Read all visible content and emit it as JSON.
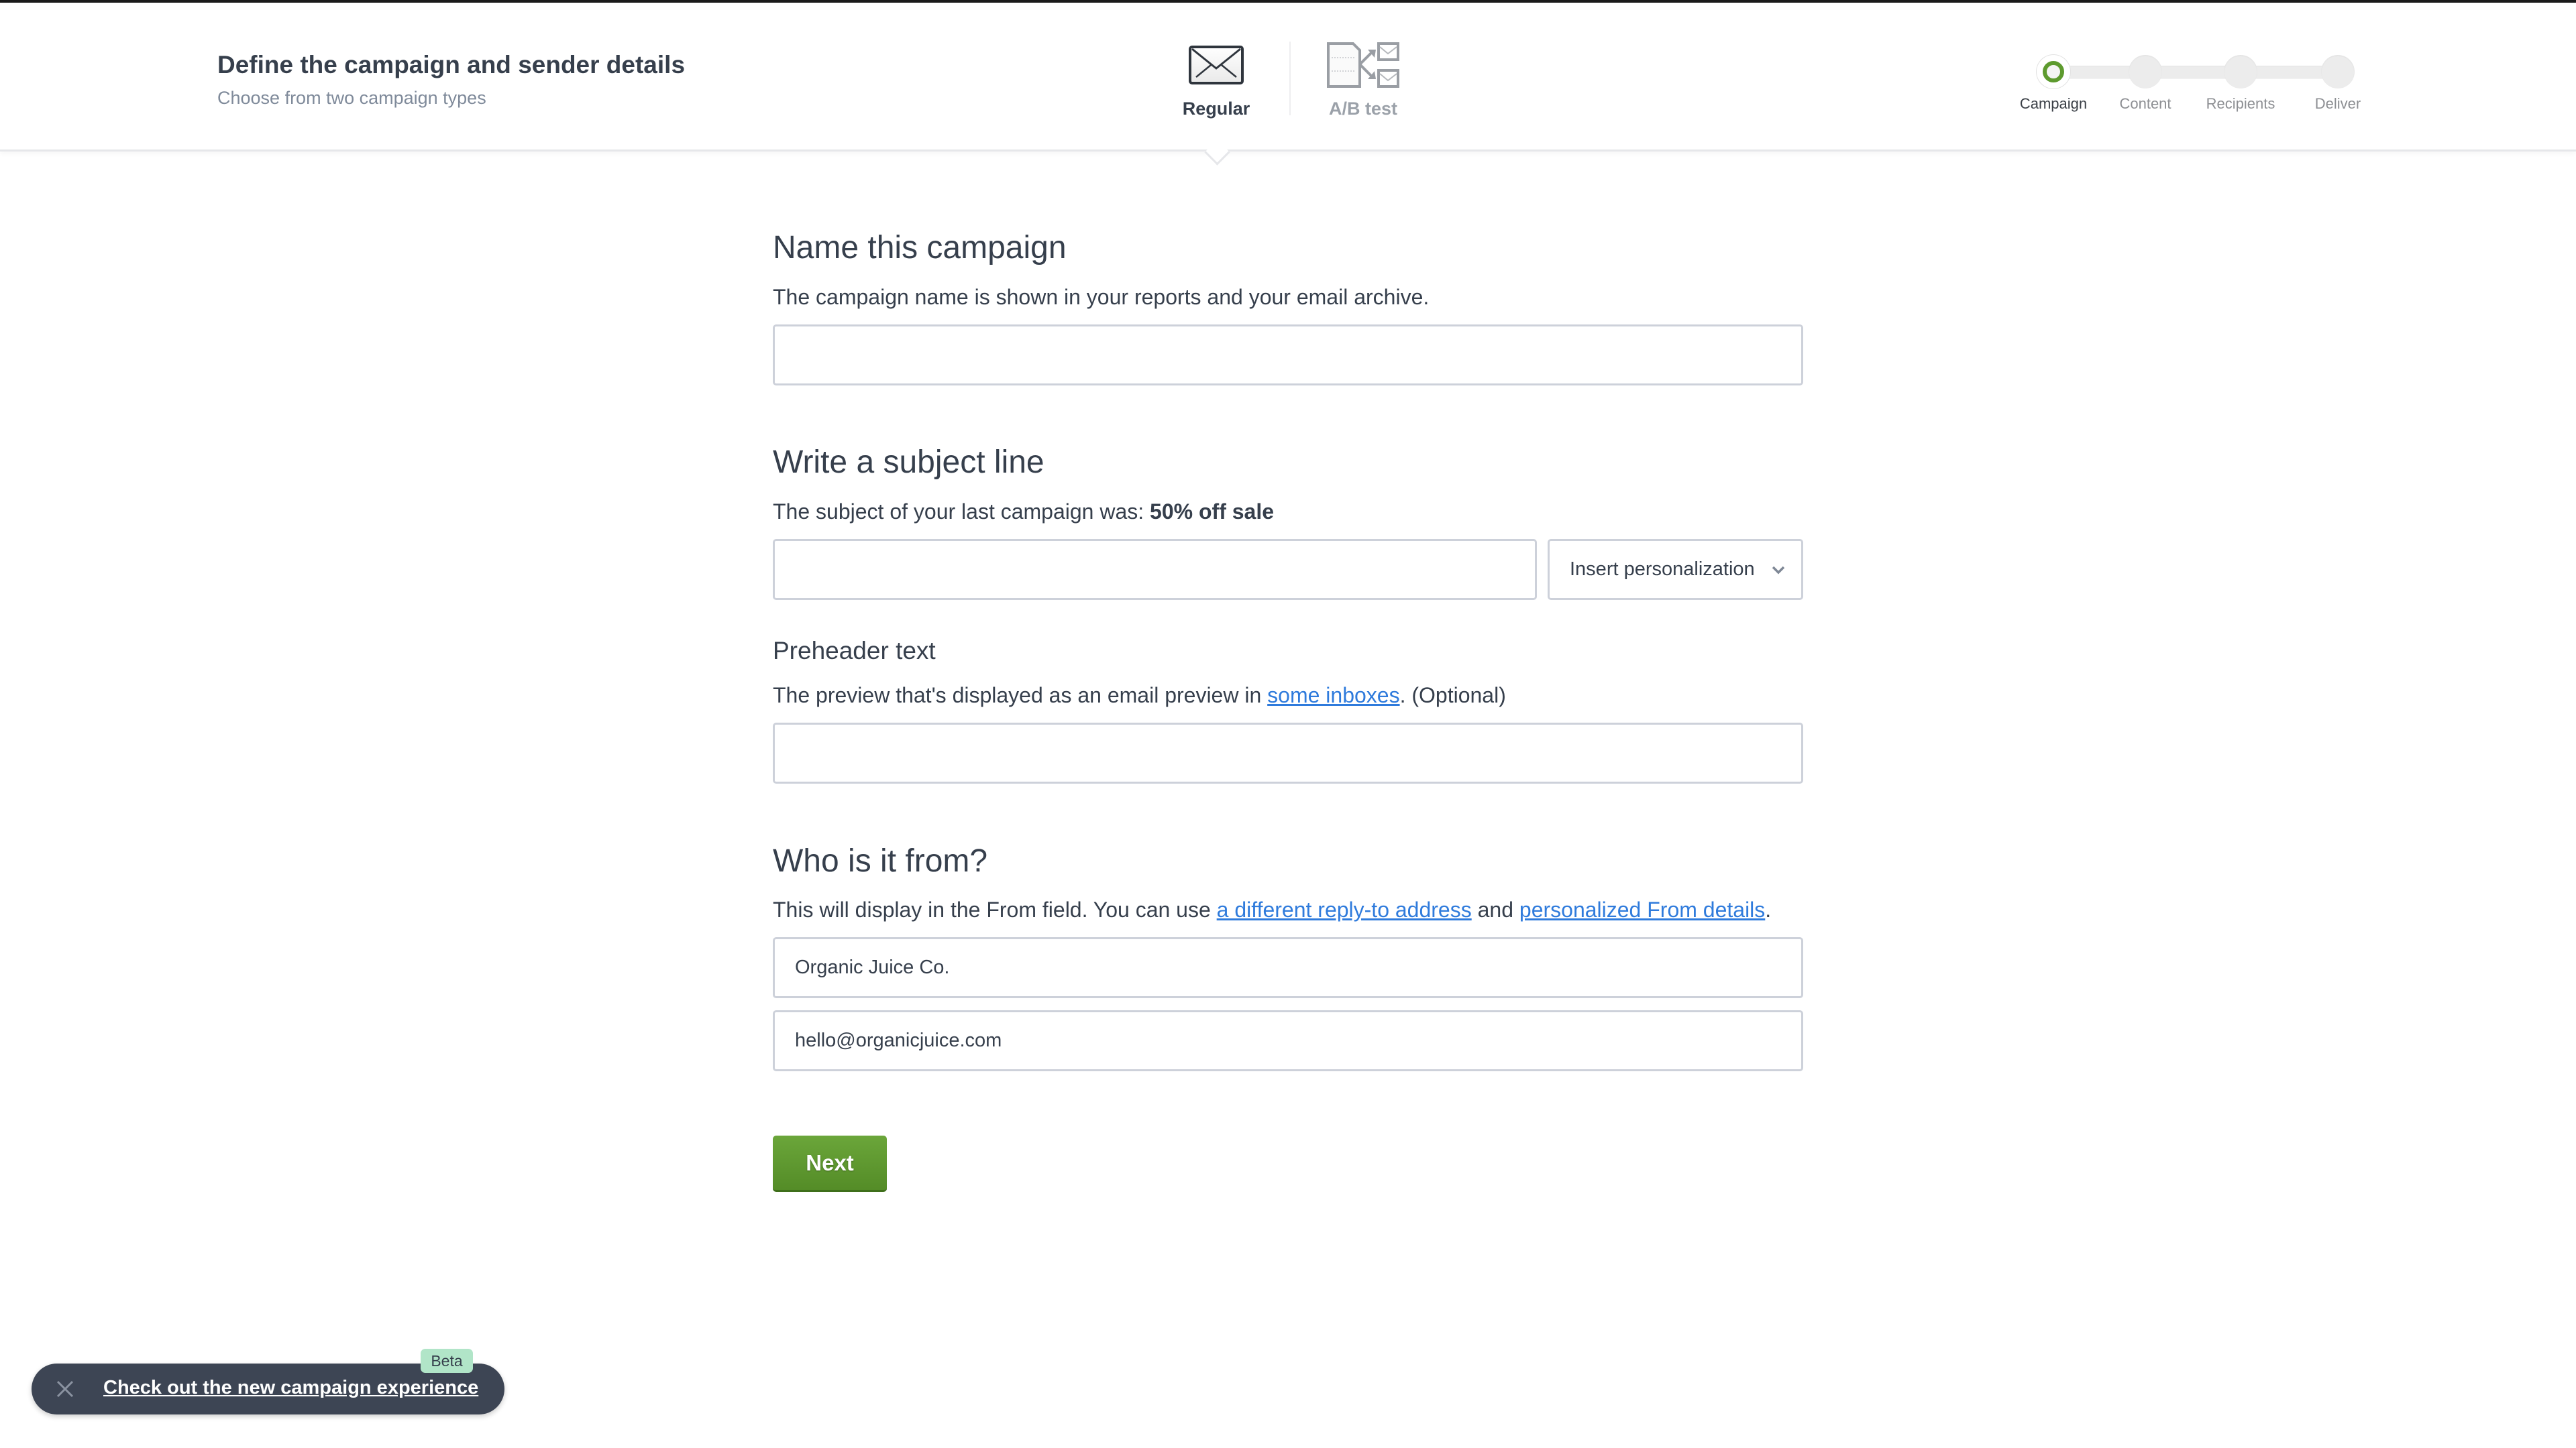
{
  "header": {
    "title": "Define the campaign and sender details",
    "subtitle": "Choose from two campaign types",
    "campaign_types": [
      {
        "label": "Regular",
        "icon": "envelope-icon",
        "selected": true
      },
      {
        "label": "A/B test",
        "icon": "ab-test-icon",
        "selected": false
      }
    ]
  },
  "stepper": {
    "steps": [
      {
        "label": "Campaign",
        "active": true
      },
      {
        "label": "Content",
        "active": false
      },
      {
        "label": "Recipients",
        "active": false
      },
      {
        "label": "Deliver",
        "active": false
      }
    ],
    "accent": "#5d9a2e"
  },
  "form": {
    "name_section": {
      "heading": "Name this campaign",
      "description": "The campaign name is shown in your reports and your email archive.",
      "value": ""
    },
    "subject_section": {
      "heading": "Write a subject line",
      "description_prefix": "The subject of your last campaign was: ",
      "last_subject": "50% off sale",
      "value": "",
      "personalization_label": "Insert personalization"
    },
    "preheader_section": {
      "heading": "Preheader text",
      "description_prefix": "The preview that's displayed as an email preview in ",
      "link": "some inboxes",
      "description_suffix": ". (Optional)",
      "value": ""
    },
    "from_section": {
      "heading": "Who is it from?",
      "description_prefix": "This will display in the From field. You can use ",
      "link_reply_to": "a different reply-to address",
      "and_text": " and ",
      "link_personalized": "personalized From details",
      "description_suffix": ".",
      "from_name": "Organic Juice Co.",
      "from_email": "hello@organicjuice.com"
    },
    "next_label": "Next",
    "next_color": "#5f9a30",
    "link_color": "#2f7bdc"
  },
  "toast": {
    "link": "Check out the new campaign experience",
    "badge": "Beta",
    "close_icon": "close-icon"
  }
}
